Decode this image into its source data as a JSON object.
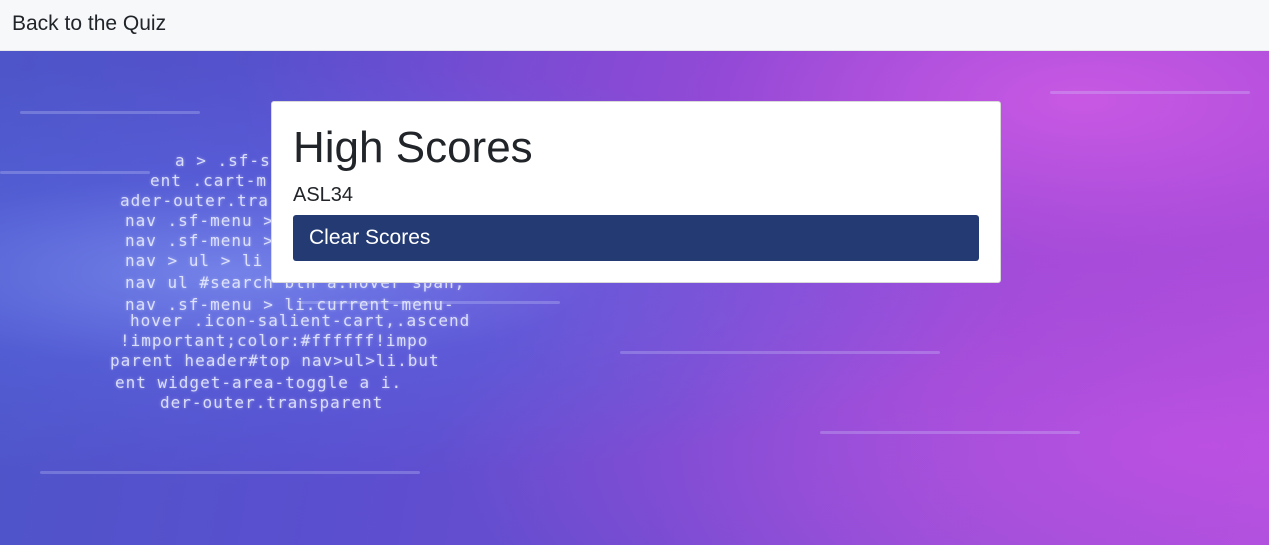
{
  "nav": {
    "back_link": "Back to the Quiz"
  },
  "background": {
    "code_lines": [
      "a > .sf-s",
      "ent .cart-m",
      "ader-outer.tra",
      "nav .sf-menu >",
      "nav .sf-menu >",
      "nav > ul > li",
      "nav ul #search btn a:hover span,",
      "nav .sf-menu > li.current-menu-",
      "hover .icon-salient-cart,.ascend",
      "!important;color:#ffffff!impo",
      "parent header#top nav>ul>li.but",
      "ent widget-area-toggle a i.",
      "der-outer.transparent"
    ]
  },
  "high_scores": {
    "title": "High Scores",
    "entries": [
      "ASL34"
    ],
    "clear_label": "Clear Scores"
  },
  "colors": {
    "button_bg": "#243a73",
    "topbar_bg": "#f7f8fa"
  }
}
